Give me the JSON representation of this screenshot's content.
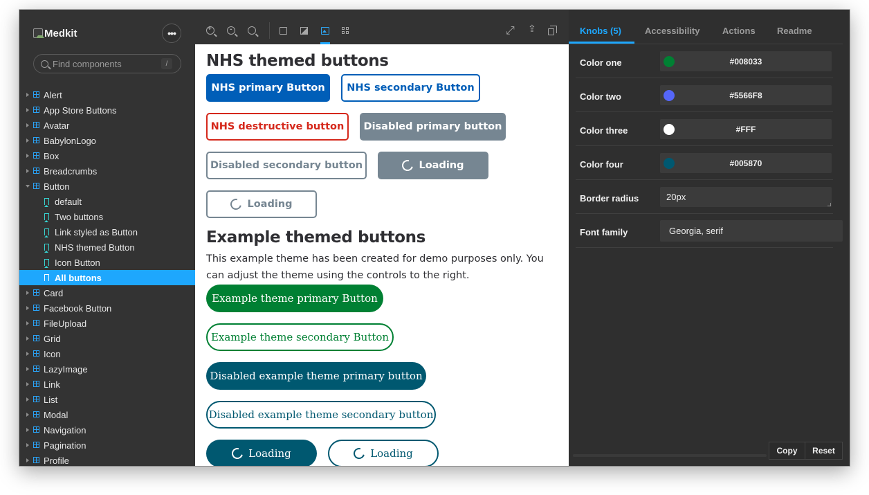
{
  "app": {
    "brand": "Medkit",
    "more_label": "•••",
    "search_placeholder": "Find components",
    "search_shortcut": "/"
  },
  "sidebar": {
    "items": [
      {
        "label": "Alert"
      },
      {
        "label": "App Store Buttons"
      },
      {
        "label": "Avatar"
      },
      {
        "label": "BabylonLogo"
      },
      {
        "label": "Box"
      },
      {
        "label": "Breadcrumbs"
      },
      {
        "label": "Button",
        "expanded": true
      },
      {
        "label": "default",
        "story": true
      },
      {
        "label": "Two buttons",
        "story": true
      },
      {
        "label": "Link styled as Button",
        "story": true
      },
      {
        "label": "NHS themed Button",
        "story": true
      },
      {
        "label": "Icon Button",
        "story": true
      },
      {
        "label": "All buttons",
        "story": true,
        "selected": true
      },
      {
        "label": "Card"
      },
      {
        "label": "Facebook Button"
      },
      {
        "label": "FileUpload"
      },
      {
        "label": "Grid"
      },
      {
        "label": "Icon"
      },
      {
        "label": "LazyImage"
      },
      {
        "label": "Link"
      },
      {
        "label": "List"
      },
      {
        "label": "Modal"
      },
      {
        "label": "Navigation"
      },
      {
        "label": "Pagination"
      },
      {
        "label": "Profile"
      }
    ]
  },
  "toolbar": {
    "icons": [
      "zoom-in-icon",
      "zoom-out-icon",
      "zoom-reset-icon",
      "grid-icon",
      "background-icon",
      "image-icon",
      "outline-icon",
      "fullscreen-icon",
      "share-icon",
      "copy-link-icon"
    ],
    "active": "image-icon"
  },
  "preview": {
    "nhs_heading": "NHS themed buttons",
    "nhs_buttons": {
      "primary": "NHS primary Button",
      "secondary": "NHS secondary Button",
      "destructive": "NHS destructive button",
      "disabled_primary": "Disabled primary button",
      "disabled_secondary": "Disabled secondary button",
      "loading_primary": "Loading",
      "loading_secondary": "Loading"
    },
    "example_heading": "Example themed buttons",
    "example_description": "This example theme has been created for demo purposes only. You can adjust the theme using the controls to the right.",
    "example_buttons": {
      "primary": "Example theme primary Button",
      "secondary": "Example theme secondary Button",
      "disabled_primary": "Disabled example theme primary button",
      "disabled_secondary": "Disabled example theme secondary button",
      "loading_primary": "Loading",
      "loading_secondary": "Loading"
    },
    "colors": {
      "nhs_blue": "#005EB8",
      "nhs_red": "#D5281B",
      "nhs_grey": "#768692",
      "theme_green": "#008033",
      "theme_teal": "#005870"
    }
  },
  "panel": {
    "tabs": [
      {
        "label": "Knobs (5)",
        "active": true
      },
      {
        "label": "Accessibility"
      },
      {
        "label": "Actions"
      },
      {
        "label": "Readme"
      }
    ],
    "knobs": [
      {
        "label": "Color one",
        "value": "#008033",
        "swatch": "#008033"
      },
      {
        "label": "Color two",
        "value": "#5566F8",
        "swatch": "#5566F8"
      },
      {
        "label": "Color three",
        "value": "#FFF",
        "swatch": "#FFFFFF"
      },
      {
        "label": "Color four",
        "value": "#005870",
        "swatch": "#005870"
      },
      {
        "label": "Border radius",
        "value": "20px"
      },
      {
        "label": "Font family",
        "value": "Georgia, serif"
      }
    ],
    "copy_label": "Copy",
    "reset_label": "Reset"
  }
}
